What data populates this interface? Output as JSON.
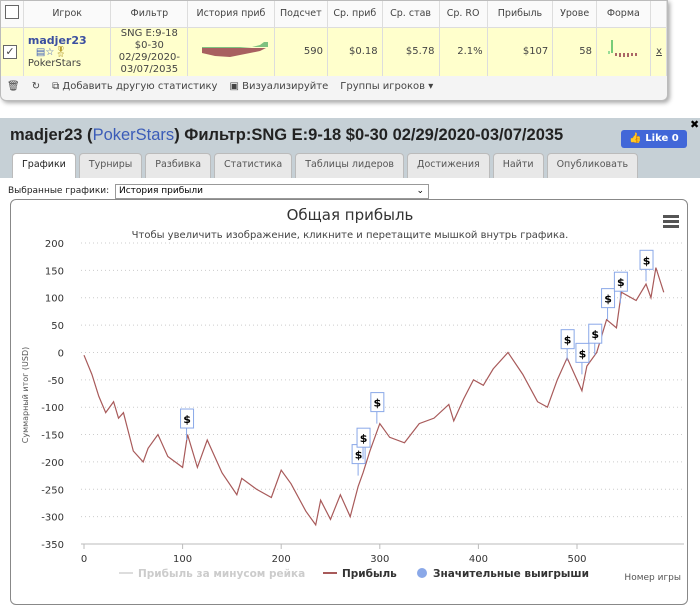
{
  "table": {
    "headers": [
      "Игрок",
      "Фильтр",
      "История приб",
      "Подсчет",
      "Ср. приб",
      "Ср. став",
      "Ср. RO",
      "Прибыль",
      "Урове",
      "Форма"
    ],
    "row": {
      "player": "madjer23",
      "site": "PokerStars",
      "filter": [
        "SNG E:9-18",
        "$0-30",
        "02/29/2020-",
        "03/07/2035"
      ],
      "count": "590",
      "avg_profit": "$0.18",
      "avg_stake": "$5.78",
      "avg_roi": "2.1%",
      "profit": "$107",
      "level": "58",
      "remove": "x"
    }
  },
  "toolbar": {
    "add_stat": "Добавить другую статистику",
    "visualize": "Визуализируйте",
    "groups": "Группы игроков ▾"
  },
  "header": {
    "player": "madjer23",
    "site": "PokerStars",
    "filter": "Фильтр:SNG E:9-18 $0-30 02/29/2020-03/07/2035",
    "like": "Like 0",
    "close": "✖"
  },
  "tabs": [
    "Графики",
    "Турниры",
    "Разбивка",
    "Статистика",
    "Таблицы лидеров",
    "Достижения",
    "Найти",
    "Опубликовать"
  ],
  "selector": {
    "label": "Выбранные графики:",
    "value": "История прибыли"
  },
  "chart_data": {
    "type": "line",
    "title": "Общая прибыль",
    "subtitle": "Чтобы увеличить изображение, кликните и перетащите мышкой внутрь графика.",
    "xlabel": "Номер игры",
    "ylabel": "Суммарный итог (USD)",
    "xlim": [
      0,
      590
    ],
    "ylim": [
      -350,
      200
    ],
    "xticks": [
      0,
      100,
      200,
      300,
      400,
      500
    ],
    "yticks": [
      200,
      150,
      100,
      50,
      0,
      -50,
      -100,
      -150,
      -200,
      -250,
      -300,
      -350
    ],
    "legend": [
      "Прибыль за минусом рейка",
      "Прибыль",
      "Значительные выигрыши"
    ],
    "series": [
      {
        "name": "Прибыль",
        "color": "#a85a5a",
        "points": [
          [
            0,
            -5
          ],
          [
            8,
            -40
          ],
          [
            15,
            -80
          ],
          [
            22,
            -110
          ],
          [
            30,
            -90
          ],
          [
            35,
            -120
          ],
          [
            40,
            -110
          ],
          [
            50,
            -180
          ],
          [
            60,
            -200
          ],
          [
            65,
            -175
          ],
          [
            75,
            -150
          ],
          [
            85,
            -190
          ],
          [
            100,
            -210
          ],
          [
            105,
            -150
          ],
          [
            115,
            -210
          ],
          [
            125,
            -160
          ],
          [
            140,
            -220
          ],
          [
            155,
            -260
          ],
          [
            160,
            -230
          ],
          [
            175,
            -250
          ],
          [
            190,
            -265
          ],
          [
            200,
            -215
          ],
          [
            210,
            -240
          ],
          [
            225,
            -290
          ],
          [
            235,
            -315
          ],
          [
            240,
            -270
          ],
          [
            250,
            -305
          ],
          [
            260,
            -260
          ],
          [
            270,
            -300
          ],
          [
            278,
            -245
          ],
          [
            283,
            -220
          ],
          [
            290,
            -180
          ],
          [
            300,
            -130
          ],
          [
            310,
            -155
          ],
          [
            325,
            -165
          ],
          [
            340,
            -130
          ],
          [
            355,
            -120
          ],
          [
            370,
            -95
          ],
          [
            375,
            -125
          ],
          [
            385,
            -85
          ],
          [
            395,
            -50
          ],
          [
            405,
            -60
          ],
          [
            415,
            -30
          ],
          [
            430,
            0
          ],
          [
            445,
            -40
          ],
          [
            460,
            -90
          ],
          [
            470,
            -100
          ],
          [
            480,
            -50
          ],
          [
            490,
            -10
          ],
          [
            505,
            -70
          ],
          [
            510,
            -25
          ],
          [
            520,
            0
          ],
          [
            530,
            60
          ],
          [
            540,
            45
          ],
          [
            545,
            110
          ],
          [
            560,
            95
          ],
          [
            570,
            125
          ],
          [
            575,
            100
          ],
          [
            580,
            155
          ],
          [
            588,
            110
          ]
        ]
      }
    ],
    "markers": [
      [
        104,
        -160
      ],
      [
        278,
        -225
      ],
      [
        283,
        -195
      ],
      [
        297,
        -130
      ],
      [
        490,
        -15
      ],
      [
        505,
        -40
      ],
      [
        518,
        -5
      ],
      [
        531,
        60
      ],
      [
        544,
        90
      ],
      [
        570,
        130
      ]
    ],
    "marker_label": "$"
  }
}
